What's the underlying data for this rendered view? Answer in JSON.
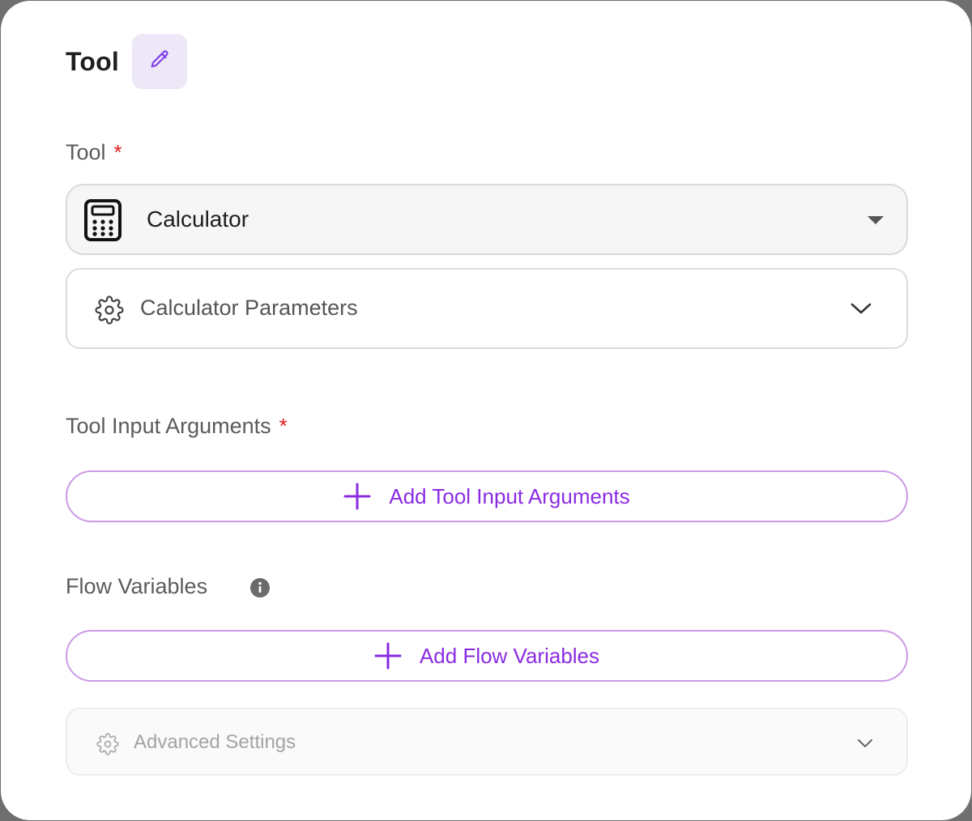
{
  "header": {
    "title": "Tool",
    "edit_icon": "pencil-icon"
  },
  "tool_field": {
    "label": "Tool",
    "required_mark": "*",
    "selected_value": "Calculator",
    "selected_icon": "calculator-icon"
  },
  "parameters_accordion": {
    "label": "Calculator Parameters",
    "icon": "gear-icon"
  },
  "tool_input_arguments": {
    "label": "Tool Input Arguments",
    "required_mark": "*",
    "add_button_label": "Add Tool Input Arguments"
  },
  "flow_variables": {
    "label": "Flow Variables",
    "info_icon": "info-icon",
    "add_button_label": "Add Flow Variables"
  },
  "advanced_settings": {
    "label": "Advanced Settings",
    "icon": "gear-icon"
  },
  "colors": {
    "accent": "#8a2be2",
    "accent_border": "#cc99e6",
    "required": "#e11d1d",
    "edit_bg": "#ede7f7"
  }
}
